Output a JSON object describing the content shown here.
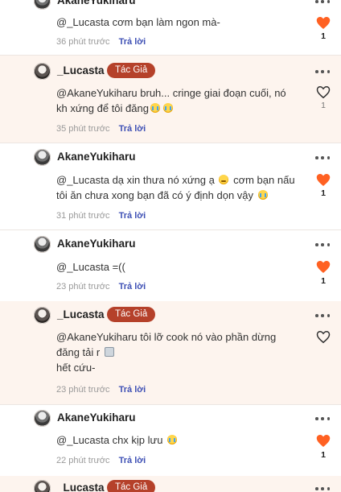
{
  "labels": {
    "author_badge": "Tác Giả",
    "reply": "Trả lời"
  },
  "colors": {
    "heart": "#ff6122",
    "badge": "#b5412a",
    "reply_link": "#3f51b5",
    "author_bg": "#fdf4ee"
  },
  "comments": [
    {
      "username": "AkaneYukiharu",
      "lines": [
        "@_Lucasta cơm bạn làm ngon mà-"
      ],
      "time": "36 phút trước",
      "likes": "1",
      "liked": true
    },
    {
      "username": "_Lucasta",
      "author": true,
      "lines": [
        "@AkaneYukiharu bruh... cringe giai đoạn cuối, nó",
        "kh xứng để tôi đăng"
      ],
      "time": "35 phút trước",
      "likes": "1",
      "liked": false
    },
    {
      "username": "AkaneYukiharu",
      "lines": [
        "@_Lucasta dạ xin thưa nó xứng ạ",
        "cơm bạn nấu",
        "tôi ăn chưa xong bạn đã có ý định dọn vậy"
      ],
      "time": "31 phút trước",
      "likes": "1",
      "liked": true
    },
    {
      "username": "AkaneYukiharu",
      "lines": [
        "@_Lucasta =(("
      ],
      "time": "23 phút trước",
      "likes": "1",
      "liked": true
    },
    {
      "username": "_Lucasta",
      "author": true,
      "lines": [
        "@AkaneYukiharu tôi lỡ cook nó vào phần dừng",
        "đăng tải r",
        "hết cứu-"
      ],
      "time": "23 phút trước",
      "likes": "",
      "liked": false
    },
    {
      "username": "AkaneYukiharu",
      "lines": [
        "@_Lucasta chx kịp lưu"
      ],
      "time": "22 phút trước",
      "likes": "1",
      "liked": true
    },
    {
      "username": "_Lucasta",
      "author": true,
      "lines": [],
      "time": "",
      "likes": "",
      "liked": false
    }
  ]
}
